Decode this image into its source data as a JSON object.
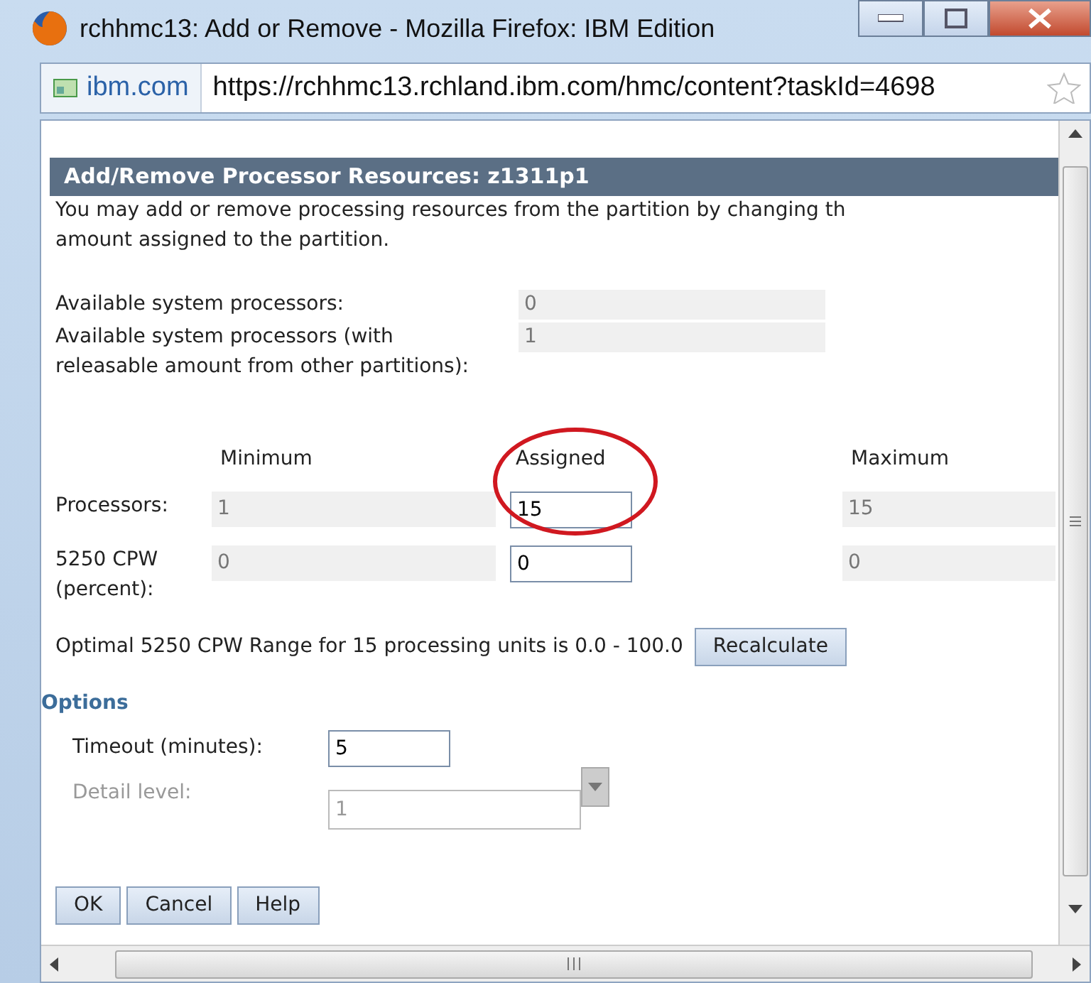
{
  "window": {
    "title": "rchhmc13: Add or Remove - Mozilla Firefox: IBM Edition"
  },
  "address_bar": {
    "site": "ibm.com",
    "url": "https://rchhmc13.rchland.ibm.com/hmc/content?taskId=4698"
  },
  "panel": {
    "title": "Add/Remove Processor Resources: z1311p1",
    "intro_lines": [
      "You may add or remove processing resources from the partition by changing th",
      "amount assigned to the partition."
    ],
    "available": [
      {
        "label": "Available system processors:",
        "value": "0"
      },
      {
        "label": "Available system processors (with releasable amount from other partitions):",
        "value": "1"
      }
    ],
    "columns": [
      "Minimum",
      "Assigned",
      "Maximum"
    ],
    "rows": [
      {
        "label": "Processors:",
        "minimum": "1",
        "assigned": "15",
        "maximum": "15"
      },
      {
        "label": "5250 CPW (percent):",
        "minimum": "0",
        "assigned": "0",
        "maximum": "0"
      }
    ],
    "range_text": "Optimal 5250 CPW Range for 15 processing units is 0.0 - 100.0",
    "recalculate_button": "Recalculate",
    "options": {
      "heading": "Options",
      "timeout": {
        "label": "Timeout (minutes):",
        "value": "5"
      },
      "detail": {
        "label": "Detail level:",
        "value": "1",
        "disabled": true
      }
    },
    "buttons": [
      "OK",
      "Cancel",
      "Help"
    ]
  }
}
